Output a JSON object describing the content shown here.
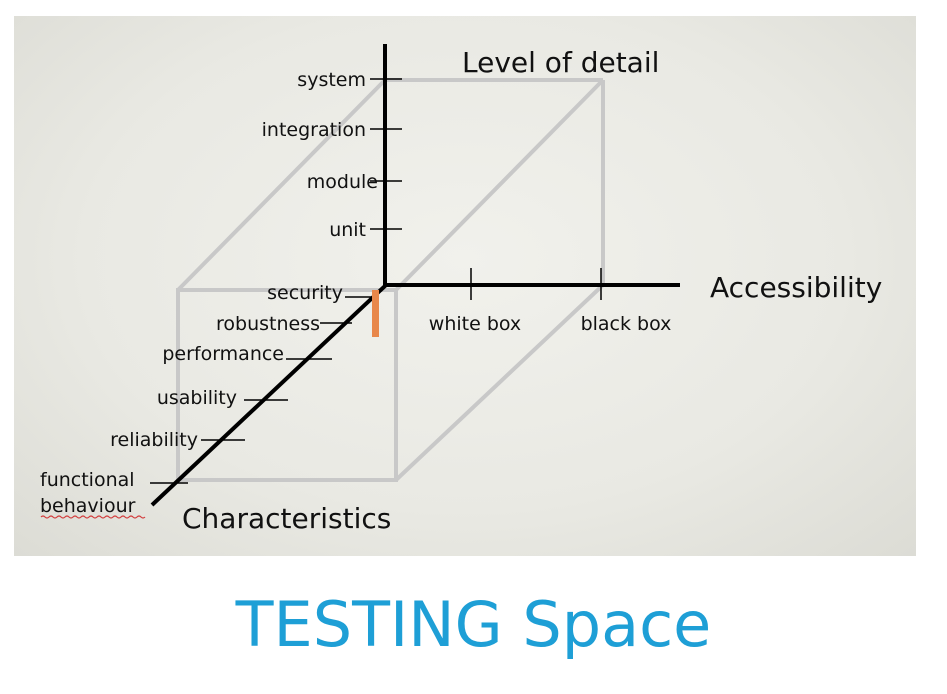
{
  "diagram": {
    "axes": {
      "vertical": "Level of detail",
      "horizontal": "Accessibility",
      "depth": "Characteristics"
    },
    "level_of_detail": [
      "system",
      "integration",
      "module",
      "unit"
    ],
    "accessibility": [
      "white box",
      "black box"
    ],
    "characteristics": [
      "security",
      "robustness",
      "performance",
      "usability",
      "reliability",
      "functional",
      "behaviour"
    ]
  },
  "footer": {
    "title": "TESTING Space",
    "title_color": "#1e9fd6"
  },
  "colors": {
    "axis": "#000000",
    "cube_edge": "#c8c8c8",
    "highlight": "#e8874a",
    "background": "#ecece6"
  }
}
